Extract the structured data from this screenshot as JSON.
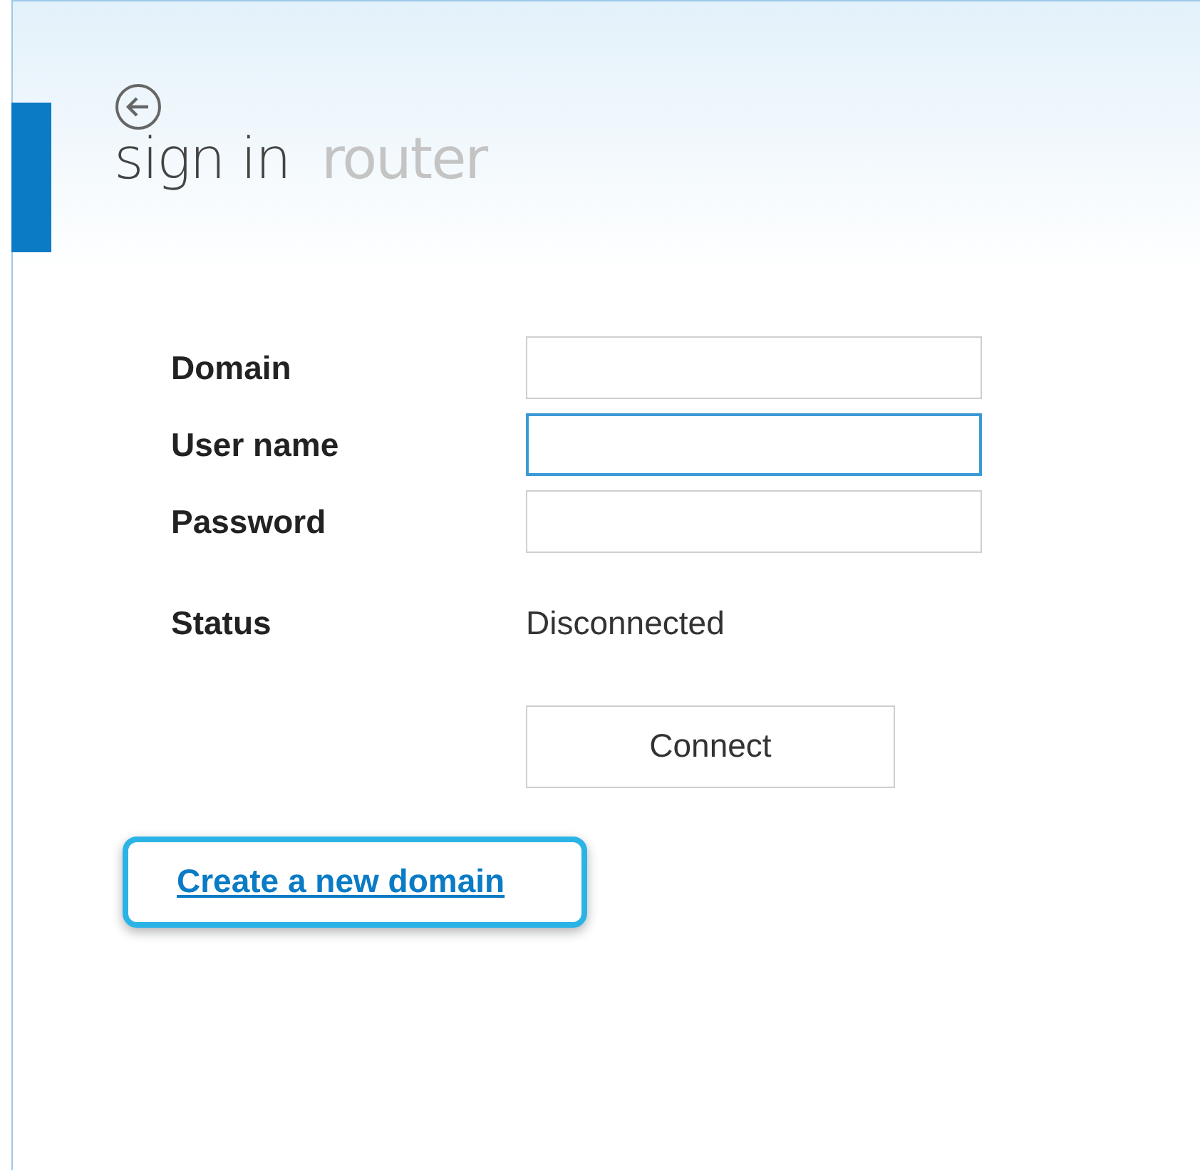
{
  "header": {
    "title": "sign in",
    "subtitle": "router"
  },
  "fields": [
    {
      "label": "Domain",
      "focused": false
    },
    {
      "label": "User name",
      "focused": true
    },
    {
      "label": "Password",
      "focused": false
    }
  ],
  "status": {
    "label": "Status",
    "value": "Disconnected"
  },
  "connect_button": {
    "label": "Connect"
  },
  "link": {
    "label": "Create a new domain",
    "highlighted": true
  }
}
